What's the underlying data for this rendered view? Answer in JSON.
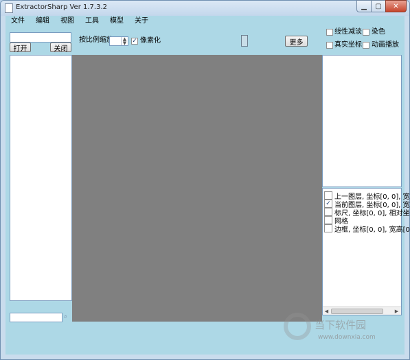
{
  "window": {
    "title": "ExtractorSharp Ver 1.7.3.2"
  },
  "menu": [
    "文件",
    "编辑",
    "视图",
    "工具",
    "模型",
    "关于"
  ],
  "left_panel": {
    "open_label": "打开",
    "close_label": "关闭",
    "path_value": "",
    "search_value": ""
  },
  "toolbar": {
    "scale_label": "按比例缩放",
    "scale_value": "",
    "pixelate_label": "像素化",
    "pixelate_checked": true,
    "more_label": "更多"
  },
  "options": {
    "linear_dodge": "线性减淡",
    "dye": "染色",
    "real_coords": "真实坐标",
    "animation": "动画播放"
  },
  "layers": [
    {
      "label": "上一图层, 坐标[0, 0], 宽高[0",
      "checked": false
    },
    {
      "label": "当前图层, 坐标[0, 0], 宽高[0",
      "checked": true
    },
    {
      "label": "标尺, 坐标[0, 0], 相对坐标[0",
      "checked": false
    },
    {
      "label": "网格",
      "checked": false
    },
    {
      "label": "边框, 坐标[0, 0], 宽高[0, 0",
      "checked": false
    }
  ],
  "watermark": {
    "brand": "当下软件园",
    "url": "www.downxia.com"
  },
  "icons": {
    "window": "app-icon",
    "minimize": "minimize-icon",
    "maximize": "maximize-icon",
    "close": "close-icon"
  }
}
